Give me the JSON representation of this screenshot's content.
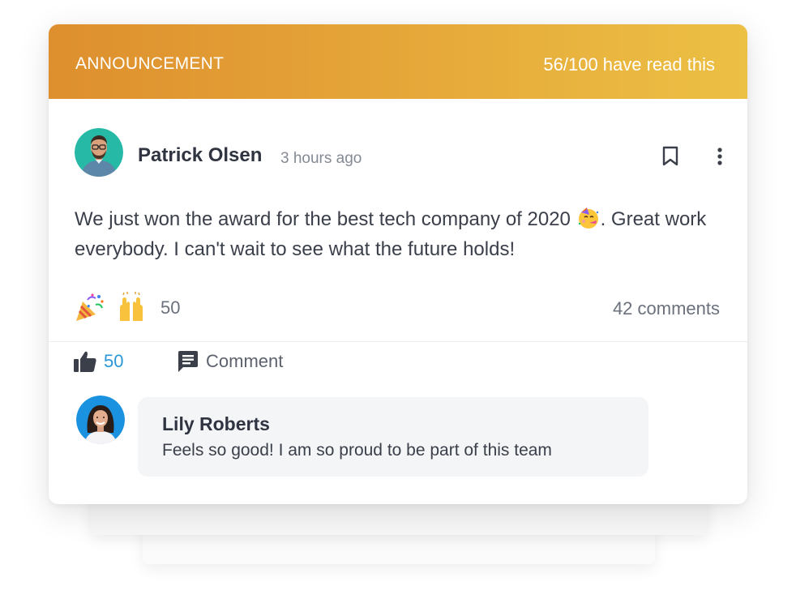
{
  "banner": {
    "label": "ANNOUNCEMENT",
    "read_status": "56/100 have read this"
  },
  "post": {
    "author": "Patrick Olsen",
    "time": "3 hours ago",
    "text_before_emoji": "We just won the award for the best tech company of 2020 ",
    "text_after_emoji": ". Great work everybody. I can't wait to see what the future holds!",
    "inline_emoji": "partying-face-icon",
    "reactions": {
      "emojis": [
        "party-popper-icon",
        "raising-hands-icon"
      ],
      "count": "50"
    },
    "comments_count": "42 comments"
  },
  "actions": {
    "like_count": "50",
    "comment_label": "Comment"
  },
  "comment": {
    "author": "Lily Roberts",
    "text": "Feels so good! I am so proud to be part of this team"
  },
  "colors": {
    "banner_start": "#de8f2e",
    "banner_end": "#ecc044",
    "like_blue": "#2b97d6",
    "avatar_teal": "#26b9a6",
    "avatar_blue": "#1a92e0"
  }
}
